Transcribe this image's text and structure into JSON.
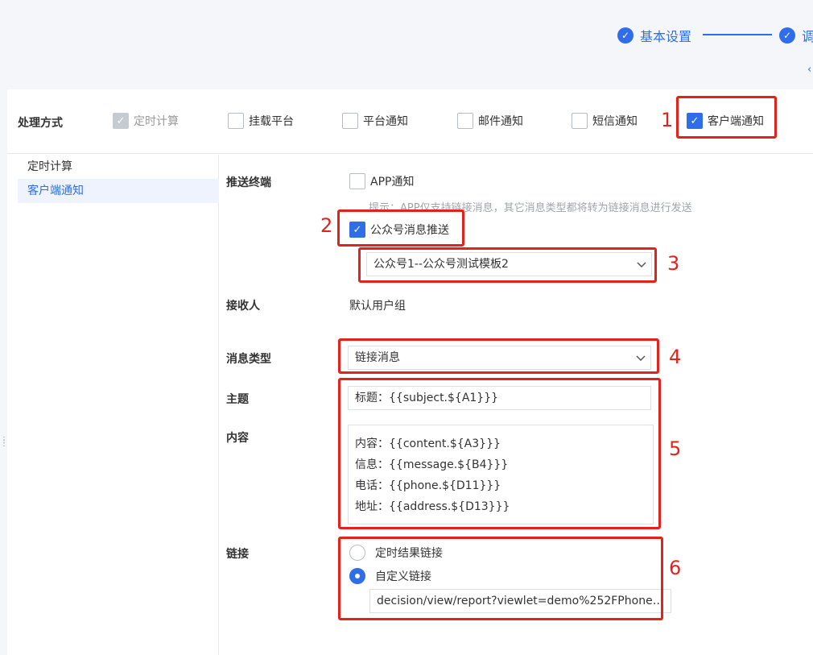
{
  "steps": [
    {
      "label": "基本设置"
    },
    {
      "label": "调"
    }
  ],
  "back_icon": "‹",
  "mode": {
    "title": "处理方式",
    "options": [
      {
        "label": "定时计算",
        "checked": true,
        "disabled": true
      },
      {
        "label": "挂载平台",
        "checked": false
      },
      {
        "label": "平台通知",
        "checked": false
      },
      {
        "label": "邮件通知",
        "checked": false
      },
      {
        "label": "短信通知",
        "checked": false
      },
      {
        "label": "客户端通知",
        "checked": true
      }
    ]
  },
  "sidebar": {
    "items": [
      {
        "label": "定时计算",
        "active": false
      },
      {
        "label": "客户端通知",
        "active": true
      }
    ]
  },
  "form": {
    "push_terminal_label": "推送终端",
    "app_notify_label": "APP通知",
    "app_hint": "提示：APP仅支持链接消息，其它消息类型都将转为链接消息进行发送",
    "wechat_push_label": "公众号消息推送",
    "template_select": "公众号1--公众号测试模板2",
    "receiver_label": "接收人",
    "receiver_value": "默认用户组",
    "msg_type_label": "消息类型",
    "msg_type_value": "链接消息",
    "subject_label": "主题",
    "subject_value": "标题：{{subject.${A1}}}",
    "content_label": "内容",
    "content_lines": [
      "内容：{{content.${A3}}}",
      "信息：{{message.${B4}}}",
      "电话：{{phone.${D11}}}",
      "地址：{{address.${D13}}}"
    ],
    "link_label": "链接",
    "link_options": [
      {
        "label": "定时结果链接",
        "selected": false
      },
      {
        "label": "自定义链接",
        "selected": true
      }
    ],
    "custom_link_value": "decision/view/report?viewlet=demo%252FPhone%252F..."
  },
  "annotations": [
    "1",
    "2",
    "3",
    "4",
    "5",
    "6"
  ],
  "colors": {
    "accent": "#2f6ee8",
    "highlight": "#e3221c"
  }
}
